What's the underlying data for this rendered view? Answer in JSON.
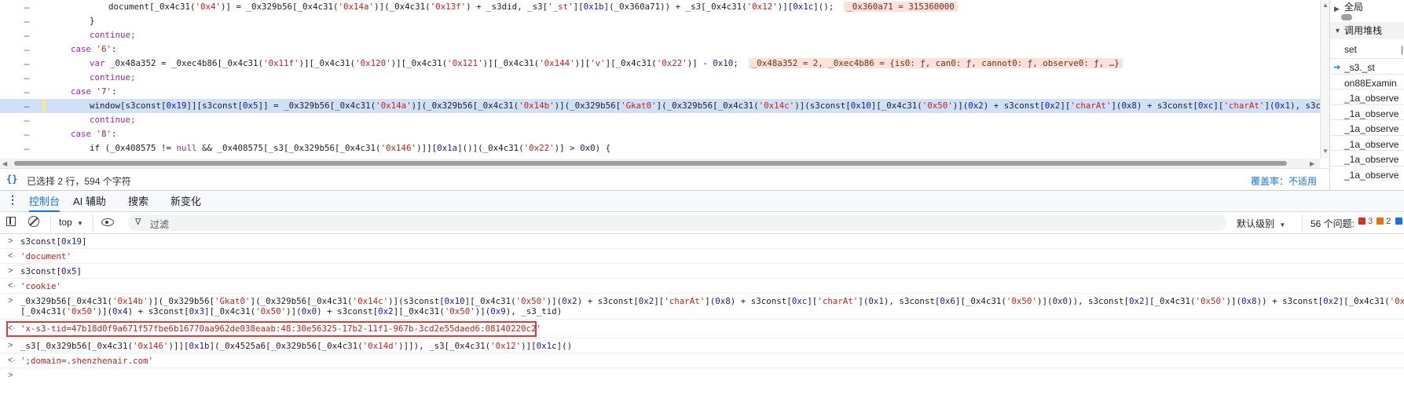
{
  "editor": {
    "lines": [
      {
        "indent": "      ",
        "segments": [
          [
            "document[_0x4c31(",
            "t"
          ],
          [
            "'0x4'",
            "s"
          ],
          [
            ")] = _0x329b56[_0x4c31(",
            "t"
          ],
          [
            "'0x14a'",
            "s"
          ],
          [
            ")](_0x4c31(",
            "t"
          ],
          [
            "'0x13f'",
            "s"
          ],
          [
            ") + _s3did, _s3[",
            "t"
          ],
          [
            "'_st'",
            "s"
          ],
          [
            "][",
            "t"
          ],
          [
            "0x1b",
            "n"
          ],
          [
            "](_0x360a71)) + _s3[_0x4c31(",
            "t"
          ],
          [
            "'0x12'",
            "s"
          ],
          [
            ")][",
            "t"
          ],
          [
            "0x1c",
            "n"
          ],
          [
            "]();",
            "t"
          ]
        ],
        "inline": "_0x360a71 = 315360000"
      },
      {
        "indent": "    ",
        "segments": [
          [
            "}",
            "t"
          ]
        ]
      },
      {
        "indent": "    ",
        "segments": [
          [
            "continue;",
            "k"
          ]
        ]
      },
      {
        "indent": "  ",
        "segments": [
          [
            "case ",
            "k"
          ],
          [
            "'6'",
            "s"
          ],
          [
            ":",
            "t"
          ]
        ]
      },
      {
        "indent": "    ",
        "segments": [
          [
            "var ",
            "k"
          ],
          [
            "_0x48a352 = _0xec4b86[_0x4c31(",
            "t"
          ],
          [
            "'0x11f'",
            "s"
          ],
          [
            ")][_0x4c31(",
            "t"
          ],
          [
            "'0x120'",
            "s"
          ],
          [
            ")][_0x4c31(",
            "t"
          ],
          [
            "'0x121'",
            "s"
          ],
          [
            ")][_0x4c31(",
            "t"
          ],
          [
            "'0x144'",
            "s"
          ],
          [
            ")][",
            "t"
          ],
          [
            "'v'",
            "s"
          ],
          [
            "][_0x4c31(",
            "t"
          ],
          [
            "'0x22'",
            "s"
          ],
          [
            ")] - ",
            "t"
          ],
          [
            "0x10",
            "n"
          ],
          [
            ";",
            "t"
          ]
        ],
        "inline": "_0x48a352 = 2, _0xec4b86 = {is0: ƒ, can0: ƒ, cannot0: ƒ, observe0: ƒ, …}"
      },
      {
        "indent": "    ",
        "segments": [
          [
            "continue;",
            "k"
          ]
        ]
      },
      {
        "indent": "  ",
        "segments": [
          [
            "case ",
            "k"
          ],
          [
            "'7'",
            "s"
          ],
          [
            ":",
            "t"
          ]
        ]
      },
      {
        "indent": "    ",
        "selected": true,
        "segments": [
          [
            "window[s3const[",
            "t"
          ],
          [
            "0x19",
            "n"
          ],
          [
            "]][s3const[",
            "t"
          ],
          [
            "0x5",
            "n"
          ],
          [
            "]] = _0x329b56[_0x4c31(",
            "t"
          ],
          [
            "'0x14a'",
            "s"
          ],
          [
            ")](_0x329b56[_0x4c31(",
            "t"
          ],
          [
            "'0x14b'",
            "s"
          ],
          [
            ")](_0x329b56[",
            "t"
          ],
          [
            "'Gkat0'",
            "s"
          ],
          [
            "](_0x329b56[_0x4c31(",
            "t"
          ],
          [
            "'0x14c'",
            "s"
          ],
          [
            ")](s3const[",
            "t"
          ],
          [
            "0x10",
            "n"
          ],
          [
            "][_0x4c31(",
            "t"
          ],
          [
            "'0x50'",
            "s"
          ],
          [
            ")](",
            "t"
          ],
          [
            "0x2",
            "n"
          ],
          [
            ") + s3const[",
            "t"
          ],
          [
            "0x2",
            "n"
          ],
          [
            "][",
            "t"
          ],
          [
            "'charAt'",
            "s"
          ],
          [
            "](",
            "t"
          ],
          [
            "0x8",
            "n"
          ],
          [
            ") + s3const[",
            "t"
          ],
          [
            "0xc",
            "n"
          ],
          [
            "][",
            "t"
          ],
          [
            "'charAt'",
            "s"
          ],
          [
            "](",
            "t"
          ],
          [
            "0x1",
            "n"
          ],
          [
            "), s3const[",
            "t"
          ],
          [
            "0x6",
            "n"
          ],
          [
            "][_0x4c31",
            "t"
          ]
        ]
      },
      {
        "indent": "    ",
        "segments": [
          [
            "continue;",
            "k"
          ]
        ]
      },
      {
        "indent": "  ",
        "segments": [
          [
            "case ",
            "k"
          ],
          [
            "'8'",
            "s"
          ],
          [
            ":",
            "t"
          ]
        ]
      },
      {
        "indent": "    ",
        "segments": [
          [
            "if (_0x408575 != ",
            "t"
          ],
          [
            "null",
            "k"
          ],
          [
            " && _0x408575[_s3[_0x329b56[_0x4c31(",
            "t"
          ],
          [
            "'0x146'",
            "s"
          ],
          [
            ")]][",
            "t"
          ],
          [
            "0x1a",
            "n"
          ],
          [
            "]()](_0x4c31(",
            "t"
          ],
          [
            "'0x22'",
            "s"
          ],
          [
            ")] > ",
            "t"
          ],
          [
            "0x0",
            "n"
          ],
          [
            ") {",
            "t"
          ]
        ]
      },
      {
        "indent": "      ",
        "segments": [
          [
            "_0x408575[_0x4c31(",
            "t"
          ],
          [
            "'0x1e'",
            "s"
          ],
          [
            ")](",
            "t"
          ],
          [
            "/(\\s*|\\t|\\r|\\n)/g",
            "s"
          ],
          [
            ", ",
            "t"
          ],
          [
            "''",
            "s"
          ],
          [
            ");",
            "t"
          ]
        ]
      }
    ]
  },
  "status_bar": {
    "icon": "curly-braces-icon",
    "selection_text": "已选择 2 行，594 个字符",
    "coverage_text": "覆盖率：不适用"
  },
  "right_pane": {
    "scope_row": "全局",
    "callstack_title": "调用堆栈",
    "set_label": "set",
    "frames": [
      "_s3._st",
      "on88Examin",
      "_1a_observe",
      "_1a_observe",
      "_1a_observe",
      "_1a_observe",
      "_1a_observe",
      "_1a_observe"
    ]
  },
  "drawer": {
    "tabs": [
      "控制台",
      "AI 辅助",
      "搜索",
      "新变化"
    ],
    "active_tab": 0
  },
  "console_toolbar": {
    "context": "top",
    "filter_placeholder": "过滤",
    "level": "默认级别",
    "issues": "56 个问题:",
    "error_count": "3",
    "warning_count": "2",
    "info_count": "2"
  },
  "console": {
    "entries": [
      {
        "kind": "input",
        "segments": [
          [
            "s3const[",
            "t"
          ],
          [
            "0x19",
            "n"
          ],
          [
            "]",
            "t"
          ]
        ]
      },
      {
        "kind": "result",
        "segments": [
          [
            "'document'",
            "s"
          ]
        ]
      },
      {
        "kind": "input",
        "segments": [
          [
            "s3const[",
            "t"
          ],
          [
            "0x5",
            "n"
          ],
          [
            "]",
            "t"
          ]
        ]
      },
      {
        "kind": "result",
        "segments": [
          [
            "'cookie'",
            "s"
          ]
        ]
      },
      {
        "kind": "input",
        "segments": [
          [
            "_0x329b56[_0x4c31(",
            "t"
          ],
          [
            "'0x14b'",
            "s"
          ],
          [
            ")](_0x329b56[",
            "t"
          ],
          [
            "'Gkat0'",
            "s"
          ],
          [
            "](_0x329b56[_0x4c31(",
            "t"
          ],
          [
            "'0x14c'",
            "s"
          ],
          [
            ")](s3const[",
            "t"
          ],
          [
            "0x10",
            "n"
          ],
          [
            "][_0x4c31(",
            "t"
          ],
          [
            "'0x50'",
            "s"
          ],
          [
            ")](",
            "t"
          ],
          [
            "0x2",
            "n"
          ],
          [
            ") + s3const[",
            "t"
          ],
          [
            "0x2",
            "n"
          ],
          [
            "][",
            "t"
          ],
          [
            "'charAt'",
            "s"
          ],
          [
            "](",
            "t"
          ],
          [
            "0x8",
            "n"
          ],
          [
            ") + s3const[",
            "t"
          ],
          [
            "0xc",
            "n"
          ],
          [
            "][",
            "t"
          ],
          [
            "'charAt'",
            "s"
          ],
          [
            "](",
            "t"
          ],
          [
            "0x1",
            "n"
          ],
          [
            "), s3const[",
            "t"
          ],
          [
            "0x6",
            "n"
          ],
          [
            "][_0x4c31(",
            "t"
          ],
          [
            "'0x50'",
            "s"
          ],
          [
            ")](",
            "t"
          ],
          [
            "0x0",
            "n"
          ],
          [
            ")), s3const[",
            "t"
          ],
          [
            "0x2",
            "n"
          ],
          [
            "][_0x4c31(",
            "t"
          ],
          [
            "'0x50'",
            "s"
          ],
          [
            ")](",
            "t"
          ],
          [
            "0x8",
            "n"
          ],
          [
            ")) + s3const[",
            "t"
          ],
          [
            "0x2",
            "n"
          ],
          [
            "][_0x4c31(",
            "t"
          ],
          [
            "'0x50'",
            "s"
          ],
          [
            ")](",
            "t"
          ],
          [
            "0x4",
            "n"
          ],
          [
            ") + s3const[",
            "t"
          ]
        ],
        "line2": [
          [
            "[_0x4c31(",
            "t"
          ],
          [
            "'0x50'",
            "s"
          ],
          [
            ")](",
            "t"
          ],
          [
            "0x4",
            "n"
          ],
          [
            ") + s3const[",
            "t"
          ],
          [
            "0x3",
            "n"
          ],
          [
            "][_0x4c31(",
            "t"
          ],
          [
            "'0x50'",
            "s"
          ],
          [
            ")](",
            "t"
          ],
          [
            "0x0",
            "n"
          ],
          [
            ") + s3const[",
            "t"
          ],
          [
            "0x2",
            "n"
          ],
          [
            "][_0x4c31(",
            "t"
          ],
          [
            "'0x50'",
            "s"
          ],
          [
            ")](",
            "t"
          ],
          [
            "0x9",
            "n"
          ],
          [
            "), _s3_tid)",
            "t"
          ]
        ]
      },
      {
        "kind": "result",
        "highlight": true,
        "segments": [
          [
            "'x-s3-tid=47b18d0f9a671f57fbe6b16770aa962de038eaab:48:30e56325-17b2-11f1-967b-3cd2e55daed6:08140220c2'",
            "s"
          ]
        ]
      },
      {
        "kind": "input",
        "segments": [
          [
            "_s3[_0x329b56[_0x4c31(",
            "t"
          ],
          [
            "'0x146'",
            "s"
          ],
          [
            ")]][",
            "t"
          ],
          [
            "0x1b",
            "n"
          ],
          [
            "](_0x4525a6[_0x329b56[_0x4c31(",
            "t"
          ],
          [
            "'0x14d'",
            "s"
          ],
          [
            ")]]), _s3[_0x4c31(",
            "t"
          ],
          [
            "'0x12'",
            "s"
          ],
          [
            ")][",
            "t"
          ],
          [
            "0x1c",
            "n"
          ],
          [
            "]()",
            "t"
          ]
        ]
      },
      {
        "kind": "result",
        "segments": [
          [
            "';domain=.shenzhenair.com'",
            "s"
          ]
        ]
      },
      {
        "kind": "prompt",
        "segments": []
      }
    ]
  }
}
